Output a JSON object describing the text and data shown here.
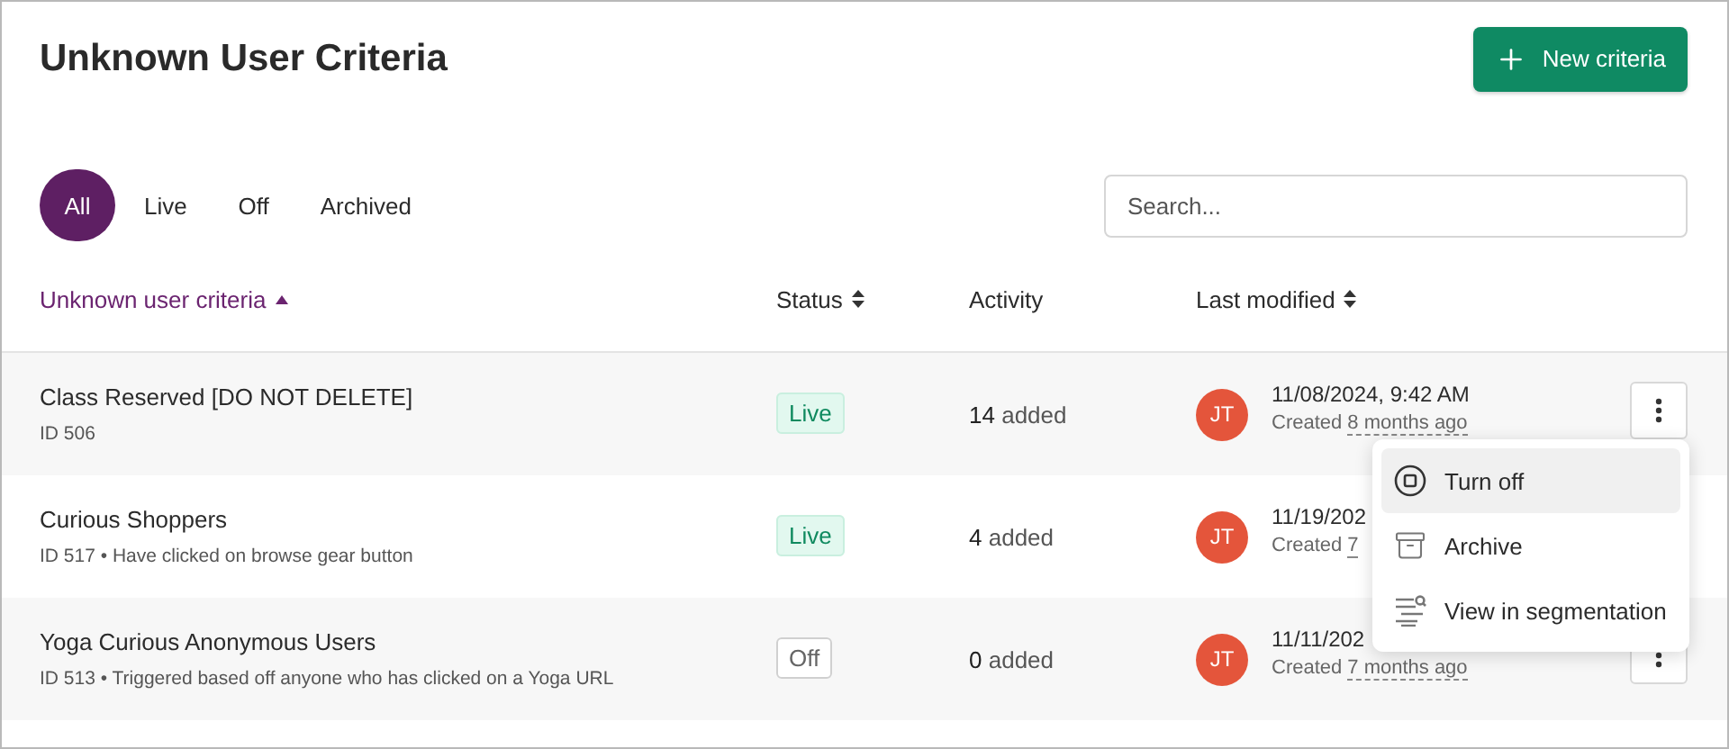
{
  "title": "Unknown User Criteria",
  "new_button": {
    "label": "New criteria"
  },
  "tabs": [
    {
      "label": "All",
      "selected": true
    },
    {
      "label": "Live",
      "selected": false
    },
    {
      "label": "Off",
      "selected": false
    },
    {
      "label": "Archived",
      "selected": false
    }
  ],
  "search": {
    "placeholder": "Search..."
  },
  "columns": [
    {
      "label": "Unknown user criteria",
      "sorted": true
    },
    {
      "label": "Status",
      "sorted": false,
      "sortable": true
    },
    {
      "label": "Activity",
      "sorted": false,
      "sortable": false
    },
    {
      "label": "Last modified",
      "sorted": false,
      "sortable": true
    }
  ],
  "rows": [
    {
      "name": "Class Reserved [DO NOT DELETE]",
      "meta": "ID 506",
      "status": {
        "label": "Live",
        "kind": "live"
      },
      "activity_count": "14",
      "activity_label": "added",
      "avatar": "JT",
      "modified": "11/08/2024, 9:42 AM",
      "created_prefix": "Created",
      "created_ago": "8 months ago",
      "menu_button": true
    },
    {
      "name": "Curious Shoppers",
      "meta": "ID 517 • Have clicked on browse gear button",
      "status": {
        "label": "Live",
        "kind": "live"
      },
      "activity_count": "4",
      "activity_label": "added",
      "avatar": "JT",
      "modified": "11/19/202",
      "created_prefix": "Created",
      "created_ago": "7",
      "menu_button": false
    },
    {
      "name": "Yoga Curious Anonymous Users",
      "meta": "ID 513 • Triggered based off anyone who has clicked on a Yoga URL",
      "status": {
        "label": "Off",
        "kind": "off"
      },
      "activity_count": "0",
      "activity_label": "added",
      "avatar": "JT",
      "modified": "11/11/202",
      "created_prefix": "Created",
      "created_ago": "7 months ago",
      "menu_button": true
    }
  ],
  "menu": {
    "items": [
      {
        "label": "Turn off",
        "kind": "stop",
        "selected": true
      },
      {
        "label": "Archive",
        "kind": "archive",
        "selected": false
      },
      {
        "label": "View in segmentation",
        "kind": "segment",
        "selected": false
      }
    ]
  }
}
